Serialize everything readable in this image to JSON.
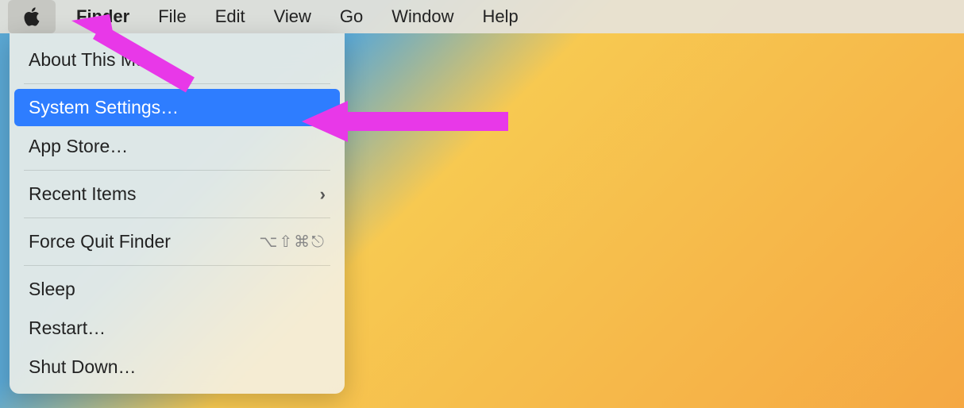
{
  "menubar": {
    "items": [
      {
        "label": "Finder",
        "bold": true
      },
      {
        "label": "File"
      },
      {
        "label": "Edit"
      },
      {
        "label": "View"
      },
      {
        "label": "Go"
      },
      {
        "label": "Window"
      },
      {
        "label": "Help"
      }
    ]
  },
  "apple_menu": {
    "about": "About This Mac",
    "system_settings": "System Settings…",
    "app_store": "App Store…",
    "recent_items": "Recent Items",
    "force_quit": "Force Quit Finder",
    "force_quit_shortcut": "⌥⇧⌘⎋",
    "sleep": "Sleep",
    "restart": "Restart…",
    "shut_down": "Shut Down…"
  },
  "annotations": {
    "arrow_color": "#e838e8"
  }
}
